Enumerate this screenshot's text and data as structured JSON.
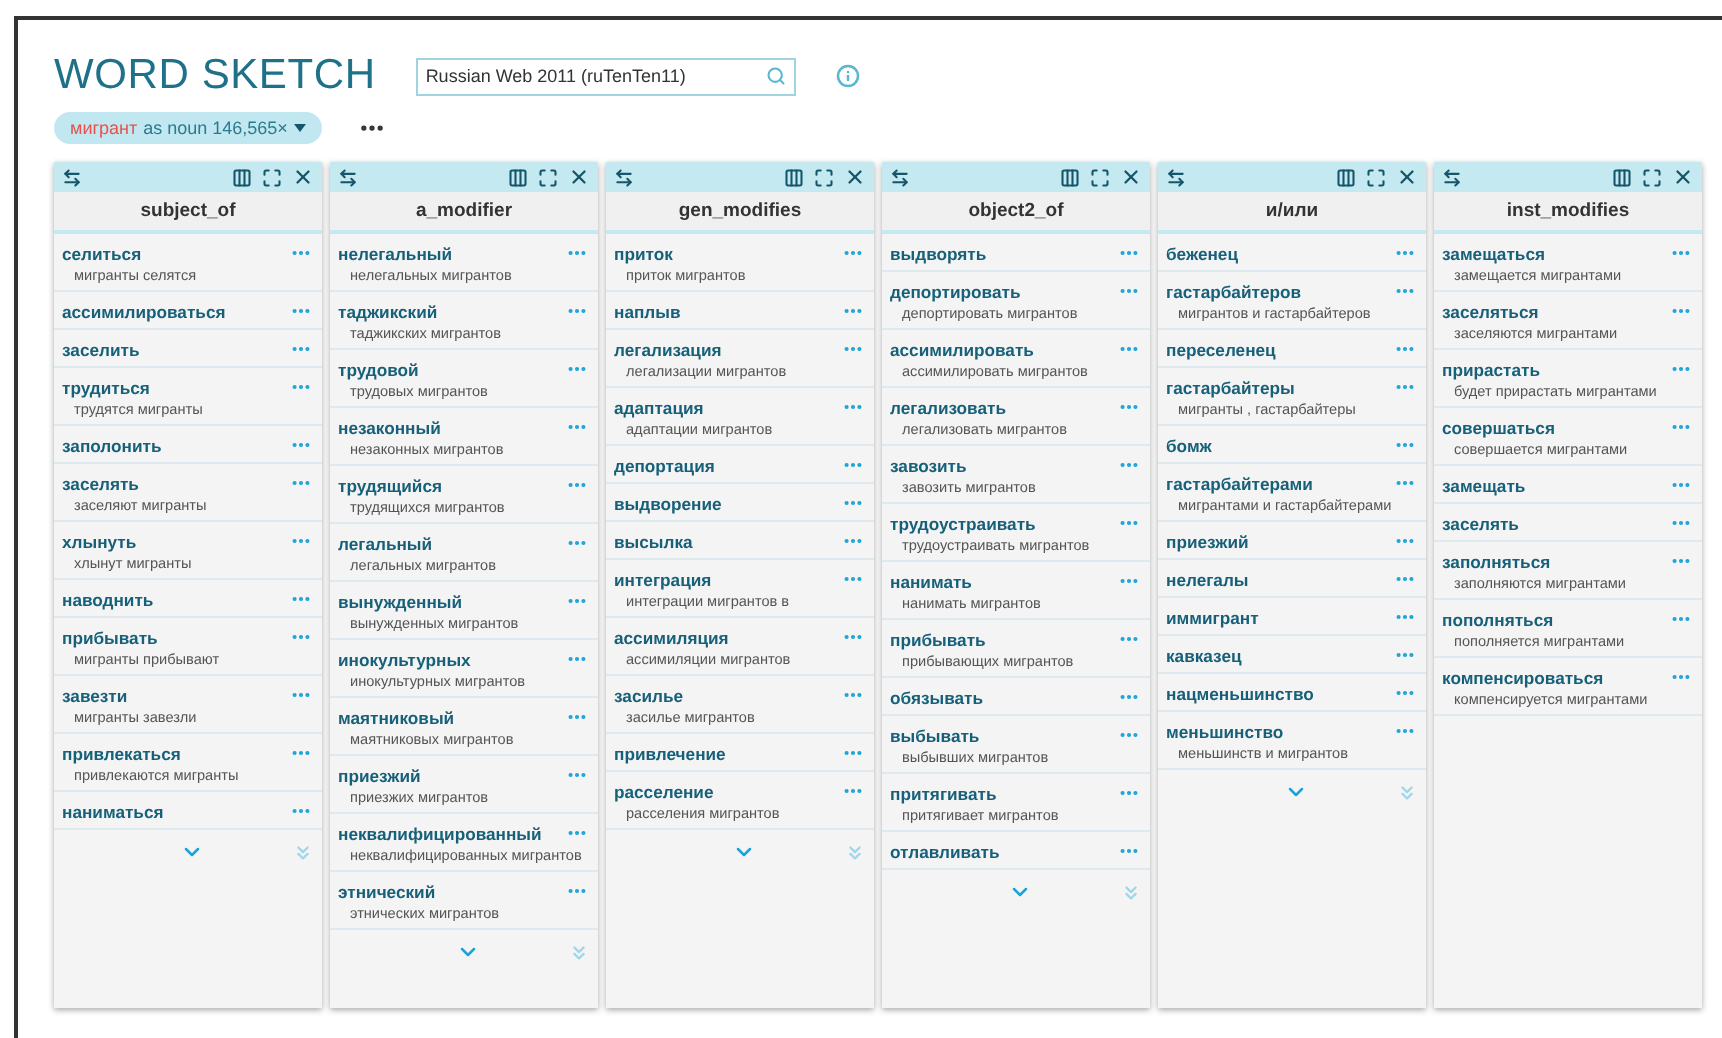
{
  "app": {
    "title": "WORD SKETCH",
    "corpus_search": {
      "value": "Russian Web 2011 (ruTenTen11)"
    }
  },
  "query": {
    "lemma": "мигрант",
    "details": "as noun 146,565×"
  },
  "columns": [
    {
      "title": "subject_of",
      "show_more": true,
      "items": [
        {
          "word": "селиться",
          "example": "мигранты селятся"
        },
        {
          "word": "ассимилироваться"
        },
        {
          "word": "заселить"
        },
        {
          "word": "трудиться",
          "example": "трудятся мигранты"
        },
        {
          "word": "заполонить"
        },
        {
          "word": "заселять",
          "example": "заселяют мигранты"
        },
        {
          "word": "хлынуть",
          "example": "хлынут мигранты"
        },
        {
          "word": "наводнить"
        },
        {
          "word": "прибывать",
          "example": "мигранты прибывают"
        },
        {
          "word": "завезти",
          "example": "мигранты завезли"
        },
        {
          "word": "привлекаться",
          "example": "привлекаются мигранты"
        },
        {
          "word": "наниматься"
        }
      ]
    },
    {
      "title": "a_modifier",
      "show_more": true,
      "items": [
        {
          "word": "нелегальный",
          "example": "нелегальных мигрантов"
        },
        {
          "word": "таджикский",
          "example": "таджикских мигрантов"
        },
        {
          "word": "трудовой",
          "example": "трудовых мигрантов"
        },
        {
          "word": "незаконный",
          "example": "незаконных мигрантов"
        },
        {
          "word": "трудящийся",
          "example": "трудящихся мигрантов"
        },
        {
          "word": "легальный",
          "example": "легальных мигрантов"
        },
        {
          "word": "вынужденный",
          "example": "вынужденных мигрантов"
        },
        {
          "word": "инокультурных",
          "example": "инокультурных мигрантов"
        },
        {
          "word": "маятниковый",
          "example": "маятниковых мигрантов"
        },
        {
          "word": "приезжий",
          "example": "приезжих мигрантов"
        },
        {
          "word": "неквалифицированный",
          "example": "неквалифицированных мигрантов"
        },
        {
          "word": "этнический",
          "example": "этнических мигрантов"
        }
      ]
    },
    {
      "title": "gen_modifies",
      "show_more": true,
      "items": [
        {
          "word": "приток",
          "example": "приток мигрантов"
        },
        {
          "word": "наплыв"
        },
        {
          "word": "легализация",
          "example": "легализации мигрантов"
        },
        {
          "word": "адаптация",
          "example": "адаптации мигрантов"
        },
        {
          "word": "депортация"
        },
        {
          "word": "выдворение"
        },
        {
          "word": "высылка"
        },
        {
          "word": "интеграция",
          "example": "интеграции мигрантов в"
        },
        {
          "word": "ассимиляция",
          "example": "ассимиляции мигрантов"
        },
        {
          "word": "засилье",
          "example": "засилье мигрантов"
        },
        {
          "word": "привлечение"
        },
        {
          "word": "расселение",
          "example": "расселения мигрантов"
        }
      ]
    },
    {
      "title": "object2_of",
      "show_more": true,
      "items": [
        {
          "word": "выдворять"
        },
        {
          "word": "депортировать",
          "example": "депортировать мигрантов"
        },
        {
          "word": "ассимилировать",
          "example": "ассимилировать мигрантов"
        },
        {
          "word": "легализовать",
          "example": "легализовать мигрантов"
        },
        {
          "word": "завозить",
          "example": "завозить мигрантов"
        },
        {
          "word": "трудоустраивать",
          "example": "трудоустраивать мигрантов"
        },
        {
          "word": "нанимать",
          "example": "нанимать мигрантов"
        },
        {
          "word": "прибывать",
          "example": "прибывающих мигрантов"
        },
        {
          "word": "обязывать"
        },
        {
          "word": "выбывать",
          "example": "выбывших мигрантов"
        },
        {
          "word": "притягивать",
          "example": "притягивает мигрантов"
        },
        {
          "word": "отлавливать"
        }
      ]
    },
    {
      "title": "и/или",
      "show_more": true,
      "items": [
        {
          "word": "беженец"
        },
        {
          "word": "гастарбайтеров",
          "example": "мигрантов и гастарбайтеров"
        },
        {
          "word": "переселенец"
        },
        {
          "word": "гастарбайтеры",
          "example": "мигранты , гастарбайтеры"
        },
        {
          "word": "бомж"
        },
        {
          "word": "гастарбайтерами",
          "example": "мигрантами и гастарбайтерами"
        },
        {
          "word": "приезжий"
        },
        {
          "word": "нелегалы"
        },
        {
          "word": "иммигрант"
        },
        {
          "word": "кавказец"
        },
        {
          "word": "нацменьшинство"
        },
        {
          "word": "меньшинство",
          "example": "меньшинств и мигрантов"
        }
      ]
    },
    {
      "title": "inst_modifies",
      "show_more": false,
      "items": [
        {
          "word": "замещаться",
          "example": "замещается мигрантами"
        },
        {
          "word": "заселяться",
          "example": "заселяются мигрантами"
        },
        {
          "word": "прирастать",
          "example": "будет прирастать мигрантами"
        },
        {
          "word": "совершаться",
          "example": "совершается мигрантами"
        },
        {
          "word": "замещать"
        },
        {
          "word": "заселять"
        },
        {
          "word": "заполняться",
          "example": "заполняются мигрантами"
        },
        {
          "word": "пополняться",
          "example": "пополняется мигрантами"
        },
        {
          "word": "компенсироваться",
          "example": "компенсируется мигрантами"
        }
      ]
    }
  ]
}
